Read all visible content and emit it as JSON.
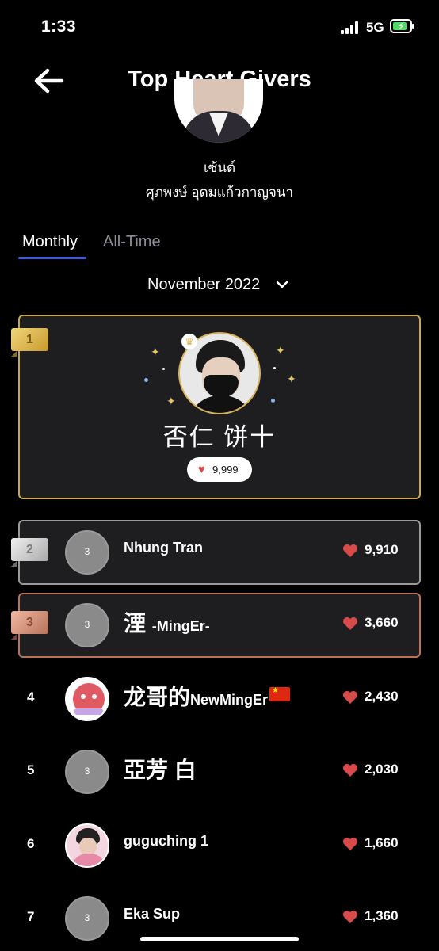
{
  "status_bar": {
    "time": "1:33",
    "network": "5G"
  },
  "header": {
    "title": "Top Heart Givers"
  },
  "profile": {
    "nickname": "เซ้นต์",
    "full_name": "ศุภพงษ์ อุดมแก้วกาญจนา"
  },
  "tabs": [
    {
      "label": "Monthly",
      "active": true
    },
    {
      "label": "All-Time",
      "active": false
    }
  ],
  "period": {
    "label": "November 2022"
  },
  "colors": {
    "gold": "#c9a84c",
    "silver": "#9a9a9a",
    "bronze": "#b8735c",
    "heart": "#d94b4b",
    "tab_accent": "#3b5bdb"
  },
  "top_giver": {
    "rank": "1",
    "name": "否仁 饼十",
    "hearts": "9,999"
  },
  "leaderboard": [
    {
      "rank": "2",
      "name": "Nhung Tran",
      "hearts": "9,910",
      "avatar": "3"
    },
    {
      "rank": "3",
      "name_large": "湮",
      "name_small": "-MingEr-",
      "hearts": "3,660",
      "avatar": "3"
    },
    {
      "rank": "4",
      "name_large": "龙哥的",
      "name_small": "NewMingEr",
      "hearts": "2,430"
    },
    {
      "rank": "5",
      "name": "亞芳 白",
      "hearts": "2,030",
      "avatar": "3"
    },
    {
      "rank": "6",
      "name": "guguching 1",
      "hearts": "1,660"
    },
    {
      "rank": "7",
      "name": "Eka Sup",
      "hearts": "1,360",
      "avatar": "3"
    }
  ]
}
